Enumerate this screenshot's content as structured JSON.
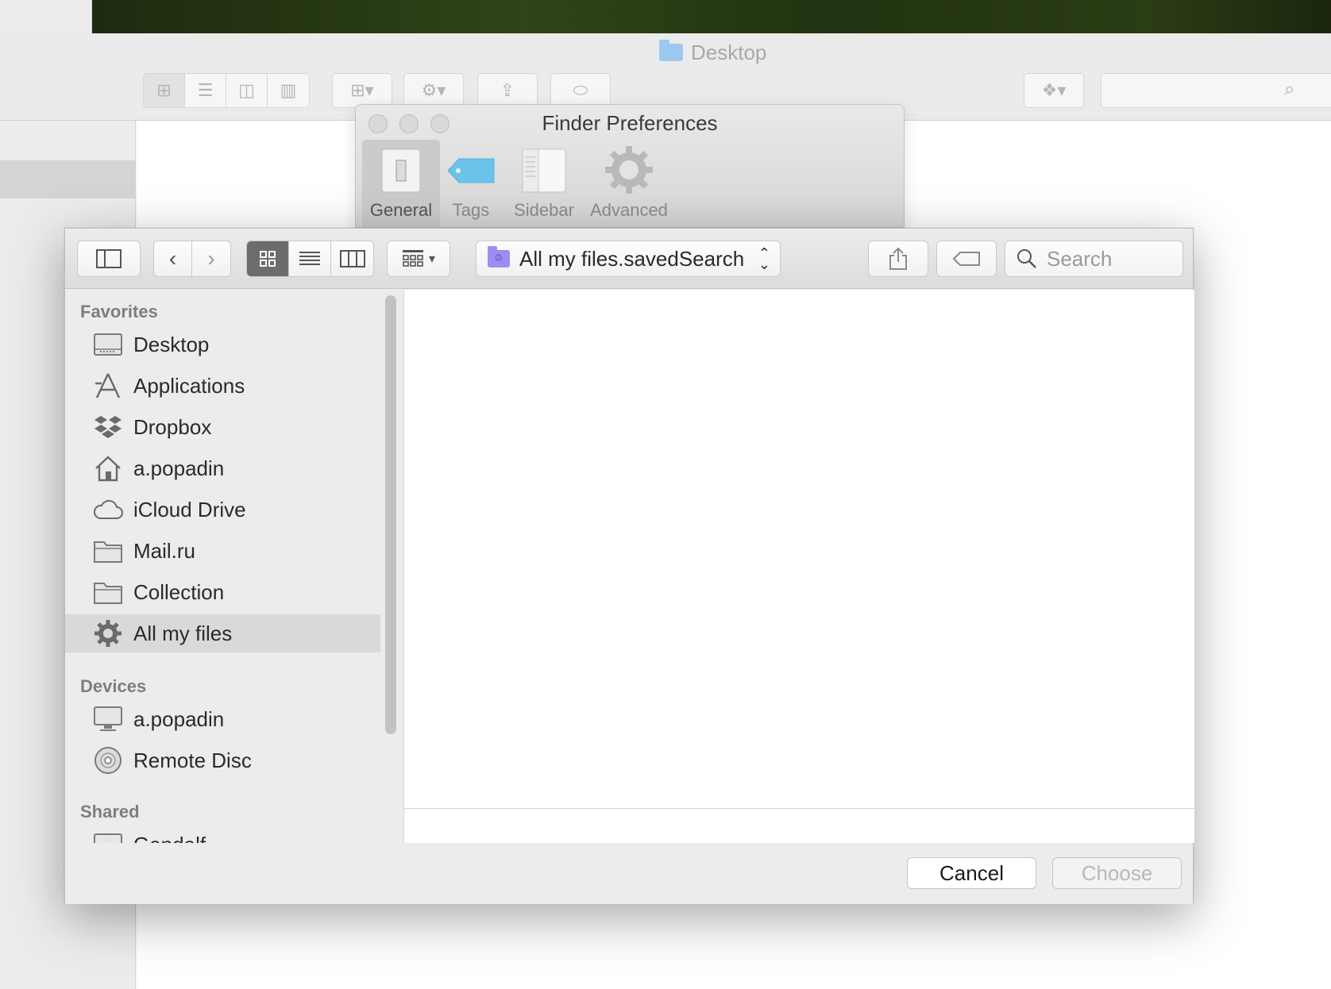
{
  "background_window": {
    "title": "Desktop"
  },
  "prefs": {
    "title": "Finder Preferences",
    "tabs": [
      {
        "label": "General"
      },
      {
        "label": "Tags"
      },
      {
        "label": "Sidebar"
      },
      {
        "label": "Advanced"
      }
    ],
    "selected_tab": "General"
  },
  "dialog": {
    "path_popup": "All my files.savedSearch",
    "search_placeholder": "Search",
    "view_mode_selected": "icon",
    "sidebar": {
      "sections": [
        {
          "title": "Favorites",
          "items": [
            {
              "label": "Desktop",
              "icon": "desktop-icon"
            },
            {
              "label": "Applications",
              "icon": "applications-icon"
            },
            {
              "label": "Dropbox",
              "icon": "dropbox-icon"
            },
            {
              "label": "a.popadin",
              "icon": "home-icon"
            },
            {
              "label": "iCloud Drive",
              "icon": "cloud-icon"
            },
            {
              "label": "Mail.ru",
              "icon": "folder-icon"
            },
            {
              "label": "Collection",
              "icon": "folder-icon"
            },
            {
              "label": "All my files",
              "icon": "gear-icon"
            }
          ]
        },
        {
          "title": "Devices",
          "items": [
            {
              "label": "a.popadin",
              "icon": "computer-icon"
            },
            {
              "label": "Remote Disc",
              "icon": "disc-icon"
            }
          ]
        },
        {
          "title": "Shared",
          "items": [
            {
              "label": "Gandalf",
              "icon": "server-icon"
            }
          ]
        }
      ],
      "selected_item": "All my files"
    },
    "buttons": {
      "cancel": "Cancel",
      "choose": "Choose"
    }
  }
}
